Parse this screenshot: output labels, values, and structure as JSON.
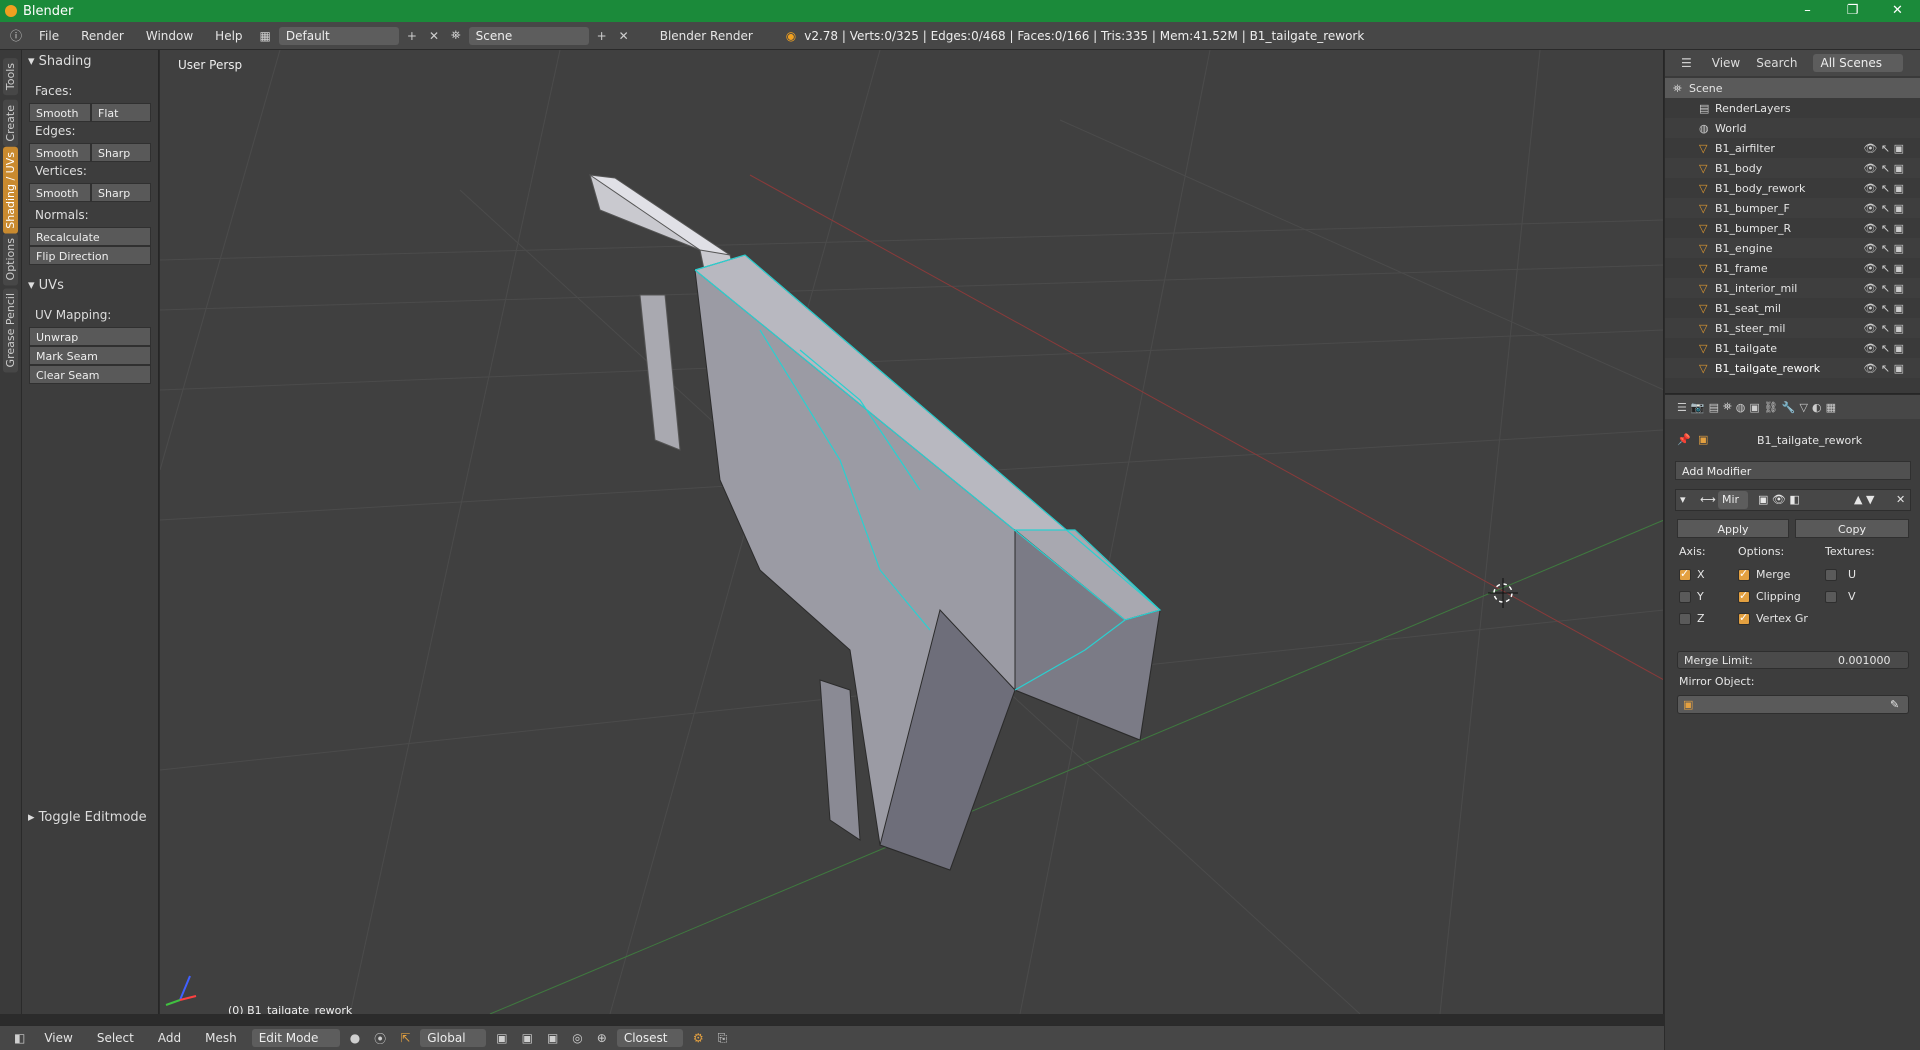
{
  "titlebar": {
    "title": "Blender",
    "minimize": "–",
    "maximize": "❐",
    "close": "✕"
  },
  "menubar": {
    "menus": [
      "File",
      "Render",
      "Window",
      "Help"
    ],
    "layout": "Default",
    "scene": "Scene",
    "engine": "Blender Render",
    "stats": "v2.78 | Verts:0/325 | Edges:0/468 | Faces:0/166 | Tris:335 | Mem:41.52M | B1_tailgate_rework"
  },
  "lefttabs": [
    "Tools",
    "Create",
    "Shading / UVs",
    "Options",
    "Grease Pencil"
  ],
  "toolshelf": {
    "shading_title": "Shading",
    "faces": "Faces:",
    "edges": "Edges:",
    "vertices": "Vertices:",
    "normals": "Normals:",
    "smooth": "Smooth",
    "flat": "Flat",
    "sharp": "Sharp",
    "recalculate": "Recalculate",
    "flip": "Flip Direction",
    "uvs_title": "UVs",
    "uv_mapping": "UV Mapping:",
    "unwrap": "Unwrap",
    "mark_seam": "Mark Seam",
    "clear_seam": "Clear Seam",
    "toggle": "Toggle Editmode"
  },
  "viewport": {
    "label": "User Persp",
    "object": "(0) B1_tailgate_rework"
  },
  "bottombar": {
    "view": "View",
    "select": "Select",
    "add": "Add",
    "mesh": "Mesh",
    "mode": "Edit Mode",
    "orientation": "Global",
    "snap": "Closest"
  },
  "outliner": {
    "view": "View",
    "search": "Search",
    "scenes": "All Scenes",
    "items": [
      "Scene",
      "RenderLayers",
      "World",
      "B1_airfilter",
      "B1_body",
      "B1_body_rework",
      "B1_bumper_F",
      "B1_bumper_R",
      "B1_engine",
      "B1_frame",
      "B1_interior_mil",
      "B1_seat_mil",
      "B1_steer_mil",
      "B1_tailgate",
      "B1_tailgate_rework"
    ]
  },
  "properties": {
    "object": "B1_tailgate_rework",
    "add_modifier": "Add Modifier",
    "modifier_name": "Mir",
    "apply": "Apply",
    "copy": "Copy",
    "axis": "Axis:",
    "options": "Options:",
    "textures": "Textures:",
    "x": "X",
    "y": "Y",
    "z": "Z",
    "merge": "Merge",
    "clipping": "Clipping",
    "vertex": "Vertex Gr",
    "u": "U",
    "v": "V",
    "merge_limit": "Merge Limit:",
    "merge_limit_value": "0.001000",
    "mirror_object": "Mirror Object:"
  },
  "colors": {
    "titlebar": "#1b8a3a",
    "accent": "#e3a040",
    "selection": "#2ad0d0"
  }
}
